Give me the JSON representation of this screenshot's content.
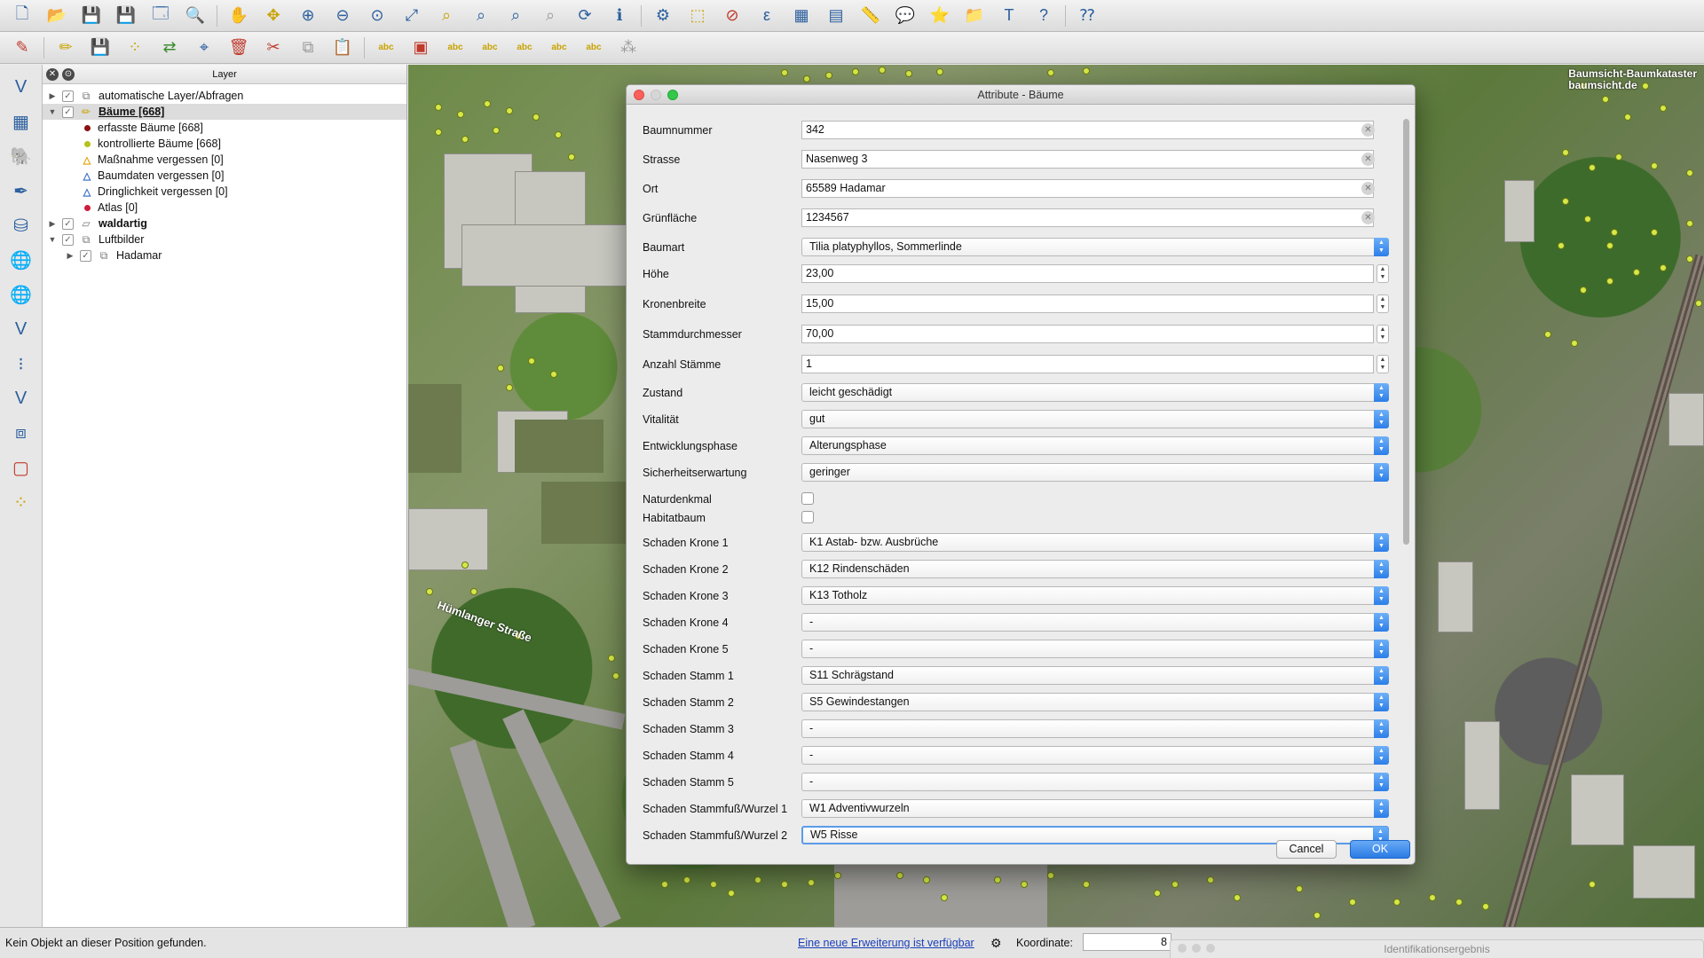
{
  "toolbar_top": {
    "icons": [
      "new-project-icon",
      "open-project-icon",
      "save-project-icon",
      "save-as-icon",
      "print-composer-icon",
      "composer-manager-icon",
      "pan-icon",
      "pan-to-selection-icon",
      "zoom-in-icon",
      "zoom-out-icon",
      "zoom-actual-icon",
      "zoom-full-icon",
      "zoom-to-selection-icon",
      "zoom-to-layer-icon",
      "zoom-last-icon",
      "zoom-next-icon",
      "refresh-icon",
      "identify-icon",
      "select-features-icon",
      "select-rect-icon",
      "deselect-icon",
      "expression-select-icon",
      "attribute-table-icon",
      "field-calculator-icon",
      "measure-icon",
      "annotation-icon",
      "bookmark-icon",
      "show-bookmarks-icon",
      "text-annotation-icon",
      "help-icon",
      "whats-this-icon"
    ]
  },
  "toolbar_edit": {
    "icons": [
      "current-edits-icon",
      "toggle-editing-icon",
      "save-edits-icon",
      "add-feature-icon",
      "move-feature-icon",
      "node-tool-icon",
      "delete-selected-icon",
      "cut-features-icon",
      "copy-features-icon",
      "paste-features-icon",
      "label-tool-icon",
      "pin-labels-icon",
      "highlight-labels-icon",
      "move-label-icon",
      "rotate-label-icon",
      "change-label-icon",
      "label-abc-icon",
      "disabled-tool-icon"
    ]
  },
  "left_toolbar": {
    "icons": [
      "add-vector-layer-icon",
      "add-raster-layer-icon",
      "add-postgis-layer-icon",
      "add-spatialite-layer-icon",
      "add-mssql-layer-icon",
      "add-wms-layer-icon",
      "add-wcs-layer-icon",
      "add-wfs-layer-icon",
      "add-delimited-text-icon",
      "new-shapefile-icon",
      "add-virtual-layer-icon",
      "new-spatialite-icon",
      "new-gps-layer-icon"
    ]
  },
  "layer_panel": {
    "title": "Layer",
    "rows": [
      {
        "label": "automatische Layer/Abfragen",
        "indent": 0,
        "expanded": false,
        "checked": true,
        "icon": "group"
      },
      {
        "label": "Bäume [668]",
        "indent": 0,
        "expanded": true,
        "checked": true,
        "icon": "pencil",
        "selected": true
      },
      {
        "label": "erfasste Bäume [668]",
        "indent": 1,
        "symbol": "dot",
        "color": "#8b1010"
      },
      {
        "label": "kontrollierte Bäume [668]",
        "indent": 1,
        "symbol": "dot",
        "color": "#b5c21a"
      },
      {
        "label": "Maßnahme vergessen [0]",
        "indent": 1,
        "symbol": "triangle",
        "color": "#e0a100"
      },
      {
        "label": "Baumdaten vergessen [0]",
        "indent": 1,
        "symbol": "triangle",
        "color": "#2f66c7"
      },
      {
        "label": "Dringlichkeit vergessen [0]",
        "indent": 1,
        "symbol": "triangle",
        "color": "#2f66c7"
      },
      {
        "label": "Atlas [0]",
        "indent": 1,
        "symbol": "dot",
        "color": "#d11a3a"
      },
      {
        "label": "waldartig",
        "indent": 0,
        "expanded": false,
        "checked": true,
        "icon": "polygon",
        "bold": true
      },
      {
        "label": "Luftbilder",
        "indent": 0,
        "expanded": true,
        "checked": true,
        "icon": "group"
      },
      {
        "label": "Hadamar",
        "indent": 1,
        "expanded": false,
        "checked": true,
        "icon": "group"
      }
    ]
  },
  "map": {
    "watermark_line1": "Baumsicht-Baumkataster",
    "watermark_line2": "baumsicht.de",
    "street_label": "Hümlanger Straße"
  },
  "dialog": {
    "title": "Attribute - Bäume",
    "fields": [
      {
        "label": "Baumnummer",
        "type": "text",
        "value": "342"
      },
      {
        "label": "Strasse",
        "type": "text",
        "value": "Nasenweg 3"
      },
      {
        "label": "Ort",
        "type": "text",
        "value": "65589 Hadamar"
      },
      {
        "label": "Grünfläche",
        "type": "text",
        "value": "1234567"
      },
      {
        "label": "Baumart",
        "type": "select",
        "value": "Tilia platyphyllos, Sommerlinde"
      },
      {
        "label": "Höhe",
        "type": "spin",
        "value": "23,00"
      },
      {
        "label": "Kronenbreite",
        "type": "spin",
        "value": "15,00"
      },
      {
        "label": "Stammdurchmesser",
        "type": "spin",
        "value": "70,00"
      },
      {
        "label": "Anzahl Stämme",
        "type": "spin",
        "value": "1"
      },
      {
        "label": "Zustand",
        "type": "select",
        "value": "leicht geschädigt"
      },
      {
        "label": "Vitalität",
        "type": "select",
        "value": "gut"
      },
      {
        "label": "Entwicklungsphase",
        "type": "select",
        "value": "Alterungsphase"
      },
      {
        "label": "Sicherheitserwartung",
        "type": "select",
        "value": "geringer"
      },
      {
        "label": "Naturdenkmal",
        "type": "checkbox",
        "value": ""
      },
      {
        "label": "Habitatbaum",
        "type": "checkbox",
        "value": ""
      },
      {
        "label": "Schaden Krone 1",
        "type": "select",
        "value": "K1 Astab- bzw. Ausbrüche"
      },
      {
        "label": "Schaden Krone 2",
        "type": "select",
        "value": "K12 Rindenschäden"
      },
      {
        "label": "Schaden Krone 3",
        "type": "select",
        "value": "K13 Totholz"
      },
      {
        "label": "Schaden Krone 4",
        "type": "select",
        "value": "-"
      },
      {
        "label": "Schaden Krone 5",
        "type": "select",
        "value": "-"
      },
      {
        "label": "Schaden Stamm 1",
        "type": "select",
        "value": "S11 Schrägstand"
      },
      {
        "label": "Schaden Stamm 2",
        "type": "select",
        "value": "S5 Gewindestangen"
      },
      {
        "label": "Schaden Stamm 3",
        "type": "select",
        "value": "-"
      },
      {
        "label": "Schaden Stamm 4",
        "type": "select",
        "value": "-"
      },
      {
        "label": "Schaden Stamm 5",
        "type": "select",
        "value": "-"
      },
      {
        "label": "Schaden Stammfuß/Wurzel 1",
        "type": "select",
        "value": "W1 Adventivwurzeln"
      },
      {
        "label": "Schaden Stammfuß/Wurzel 2",
        "type": "select",
        "value": "W5 Risse",
        "focused": true
      }
    ],
    "cancel_label": "Cancel",
    "ok_label": "OK"
  },
  "statusbar": {
    "message": "Kein Objekt an dieser Position gefunden.",
    "update_link": "Eine neue Erweiterung ist verfügbar",
    "coord_label": "Koordinate:",
    "coord_value": "8",
    "identify_panel_title": "Identifikationsergebnis"
  }
}
